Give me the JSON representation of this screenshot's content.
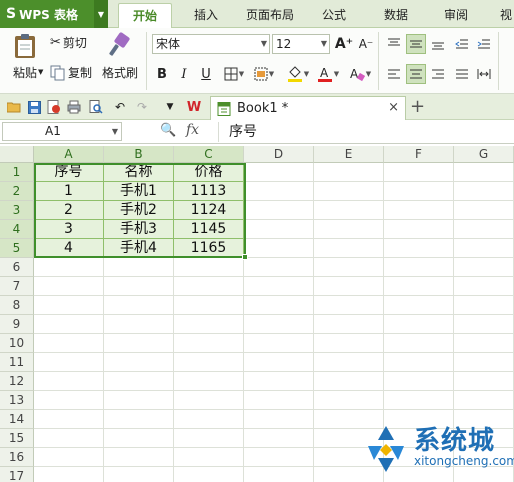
{
  "app": {
    "logo_glyph": "S",
    "title": "WPS 表格",
    "accent": "#4c8f2b"
  },
  "menu": {
    "tabs": [
      {
        "label": "开始",
        "active": true
      },
      {
        "label": "插入"
      },
      {
        "label": "页面布局"
      },
      {
        "label": "公式"
      },
      {
        "label": "数据"
      },
      {
        "label": "审阅"
      },
      {
        "label": "视"
      }
    ]
  },
  "ribbon": {
    "cut": "剪切",
    "paste": "粘贴",
    "copy": "复制",
    "format_painter": "格式刷",
    "font_name": "宋体",
    "font_size": "12",
    "bold": "B",
    "italic": "I",
    "underline": "U",
    "grow_font": "A⁺",
    "shrink_font": "A⁻"
  },
  "doc_tab": {
    "name": "Book1 *",
    "close": "×",
    "new_tab": "+"
  },
  "formula_bar": {
    "cell_ref": "A1",
    "fx": "fx",
    "content": "序号"
  },
  "sheet": {
    "columns": [
      "A",
      "B",
      "C",
      "D",
      "E",
      "F",
      "G"
    ],
    "rows": [
      "1",
      "2",
      "3",
      "4",
      "5",
      "6",
      "7",
      "8",
      "9",
      "10",
      "11",
      "12",
      "13",
      "14",
      "15",
      "16",
      "17"
    ],
    "data": [
      [
        "序号",
        "名称",
        "价格"
      ],
      [
        "1",
        "手机1",
        "1113"
      ],
      [
        "2",
        "手机2",
        "1124"
      ],
      [
        "3",
        "手机3",
        "1145"
      ],
      [
        "4",
        "手机4",
        "1165"
      ]
    ]
  },
  "watermark": {
    "text": "系统城",
    "url": "xitongcheng.com",
    "color": "#1f6fb5"
  }
}
